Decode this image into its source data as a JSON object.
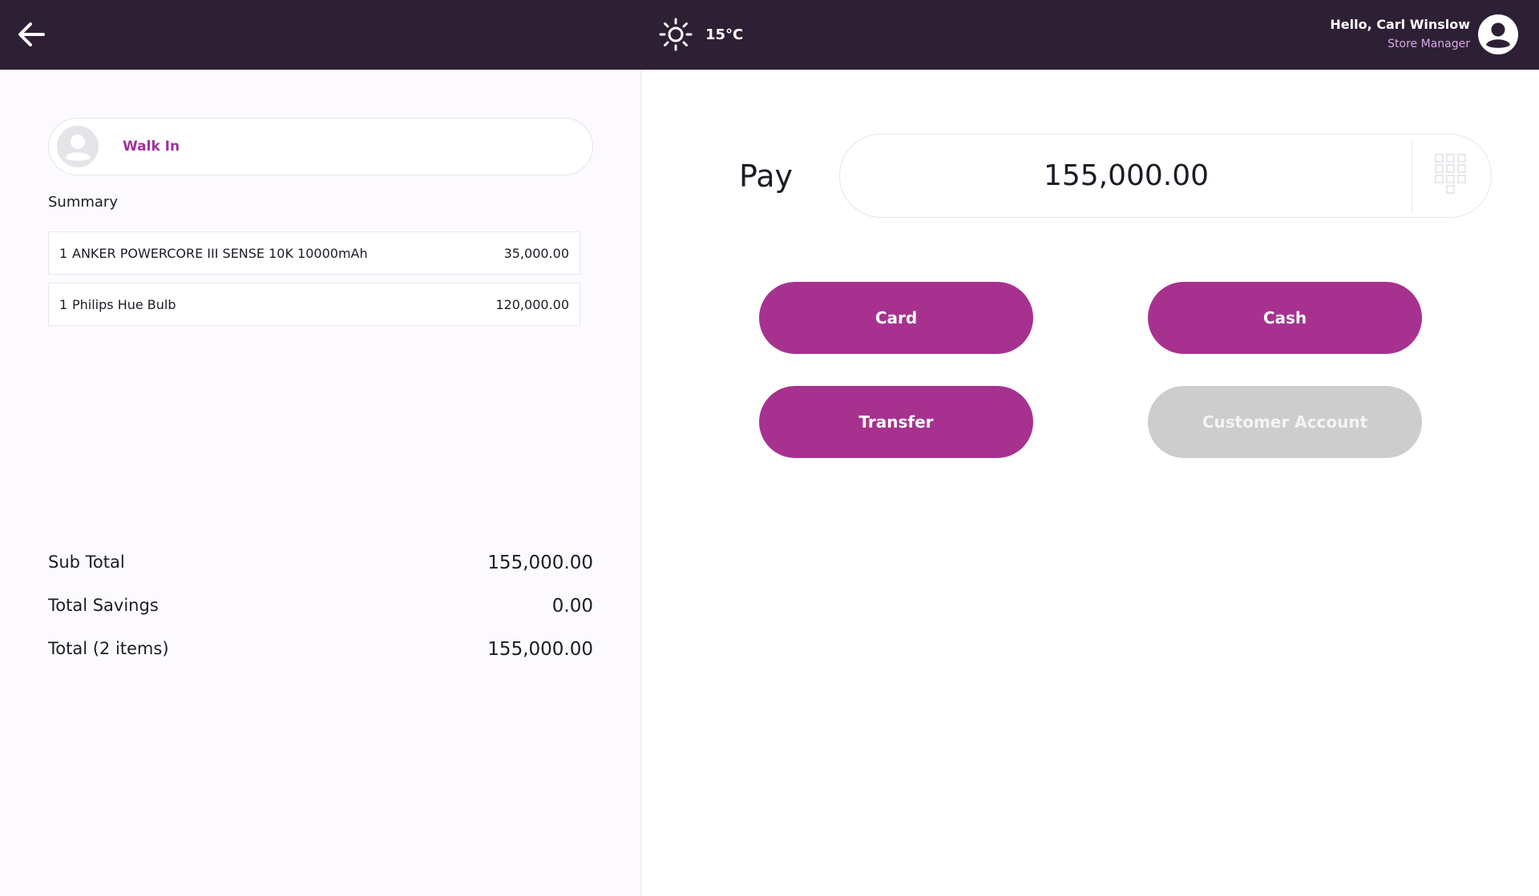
{
  "header": {
    "weather_temp": "15°C",
    "user_greeting": "Hello, Carl Winslow",
    "user_role": "Store Manager"
  },
  "customer": {
    "name": "Walk In"
  },
  "summary": {
    "label": "Summary",
    "items": [
      {
        "qty": "1",
        "name": "ANKER POWERCORE III SENSE 10K 10000mAh",
        "price": "35,000.00"
      },
      {
        "qty": "1",
        "name": "Philips Hue Bulb",
        "price": "120,000.00"
      }
    ]
  },
  "totals": {
    "sub_total_label": "Sub Total",
    "sub_total_value": "155,000.00",
    "savings_label": "Total Savings",
    "savings_value": "0.00",
    "total_label": "Total (2 items)",
    "total_value": "155,000.00"
  },
  "payment": {
    "pay_label": "Pay",
    "amount": "155,000.00",
    "methods": {
      "card": "Card",
      "cash": "Cash",
      "transfer": "Transfer",
      "customer_account": "Customer Account"
    }
  },
  "colors": {
    "topbar": "#2d2034",
    "accent": "#a7318f",
    "disabled": "#cdcdcd",
    "customer_name": "#a3309a"
  },
  "icons": {
    "back": "arrow-left-icon",
    "weather": "sun-icon",
    "user": "user-avatar-icon",
    "customer": "customer-avatar-icon",
    "keypad": "keypad-icon"
  }
}
